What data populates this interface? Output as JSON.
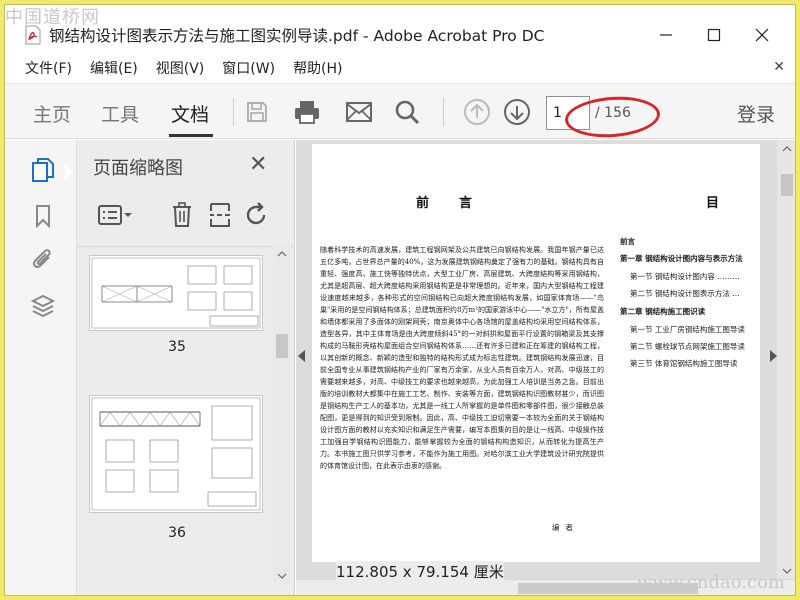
{
  "watermarks": {
    "top_left": "中国道桥网",
    "bottom_right": "www.cndao.com"
  },
  "window": {
    "title": "钢结构设计图表示方法与施工图实例导读.pdf - Adobe Acrobat Pro DC",
    "minimize": "—",
    "maximize": "☐",
    "close": "✕"
  },
  "menu": {
    "items": [
      "文件(F)",
      "编辑(E)",
      "视图(V)",
      "窗口(W)",
      "帮助(H)"
    ],
    "close_doc": "✕"
  },
  "toolbar": {
    "tabs": [
      "主页",
      "工具",
      "文档"
    ],
    "active_tab": "文档",
    "page_current": "1",
    "page_total": "/ 156",
    "login": "登录",
    "icons": [
      "save-icon",
      "print-icon",
      "mail-icon",
      "search-icon",
      "page-up-icon",
      "page-down-icon"
    ],
    "accent": "#1a73c9",
    "annotation_color": "#d9252a"
  },
  "leftrail": {
    "icons": [
      "page-thumbnails-icon",
      "bookmark-icon",
      "attachment-icon",
      "layers-icon"
    ]
  },
  "thumbnail_panel": {
    "title": "页面缩略图",
    "close": "✕",
    "tools": [
      "options-menu-icon",
      "delete-icon",
      "extract-icon",
      "rotate-icon"
    ],
    "thumbnails": [
      {
        "label": "35"
      },
      {
        "label": "36"
      }
    ]
  },
  "document": {
    "left_heading": "前言",
    "body": "随着科学技术的高速发展，建筑工程钢网架及公共建筑已向钢结构发展。我国年钢产量已达五亿多吨，占世界总产量的40%，这为发展建筑钢结构奠定了强有力的基础。钢结构具有自重轻、强度高、施工快等独特优点，大型工业厂房、高层建筑、大跨度结构等采用钢结构，尤其是超高层、超大跨度结构采用钢结构更是非常理想的。近年来，国内大型钢结构工程建设速度越来越多，各种形式的空间钢结构已向超大跨度钢结构发展，如国家体育场——\"鸟巢\"采用的是空间钢结构体系；总建筑面积约8万m²的国家游泳中心——\"水立方\"，所有屋盖和墙体都采用了多面体的刚架网壳；南京奥体中心各场馆的屋盖结构均采用空间结构体系，造型各异，其中主体育场是由大跨度倾斜45°的一对斜拱和屋面平行设置的钢箱梁及其支撑构成的马鞍形壳结构屋面组合空间钢结构体系……还有许多已建和正在筹建的钢结构工程，以其创新的概念、新颖的造型和独特的结构形式成为标志性建筑。建筑钢结构发展迅速，目前全国专业从事建筑钢结构产业的厂家有万余家，从业人员有百余万人，对高、中级技工的需要越来越多，对高、中级技工的要求也越来越高，为此加强工人培训是当务之急。目前出版的培训教材大都集中在施工工艺、制作、安装等方面，建筑钢结构识图教材甚少，而识图是钢结构生产工人的基本功，尤其是一线工人所掌握的是单件图和零部件图，很少接触总装配图，更是得到的知识受到限制。因此，高、中级技工迫切需要一本较为全面的关于钢结构设计图方面的教材以充实知识和满足生产需要，编写本图集的目的是让一线高、中级操作技工加强自学钢结构识图能力，能够掌握较为全面的钢结构构造知识，从而转化为提高生产力。本书施工图只供学习参考，不能作为施工用图。对哈尔滨工业大学建筑设计研究院提供的体育馆设计图，在此表示由衷的感谢。",
    "signature": "编者",
    "toc_heading": "目",
    "toc": [
      {
        "text": "前言",
        "kind": "ch"
      },
      {
        "text": "第一章  钢结构设计图内容与表示方法",
        "kind": "ch"
      },
      {
        "text": "第一节  钢结构设计图内容 ………",
        "kind": "sec"
      },
      {
        "text": "第二节  钢结构设计图表示方法 …",
        "kind": "sec"
      },
      {
        "text": "第二章  钢结构施工图识读",
        "kind": "ch"
      },
      {
        "text": "第一节  工业厂房钢结构施工图导读",
        "kind": "sec"
      },
      {
        "text": "第二节  螺栓球节点网架施工图导读",
        "kind": "sec"
      },
      {
        "text": "第三节  体育馆钢结构施工图导读",
        "kind": "sec"
      }
    ],
    "page_size": "112.805 x 79.154 厘米"
  }
}
